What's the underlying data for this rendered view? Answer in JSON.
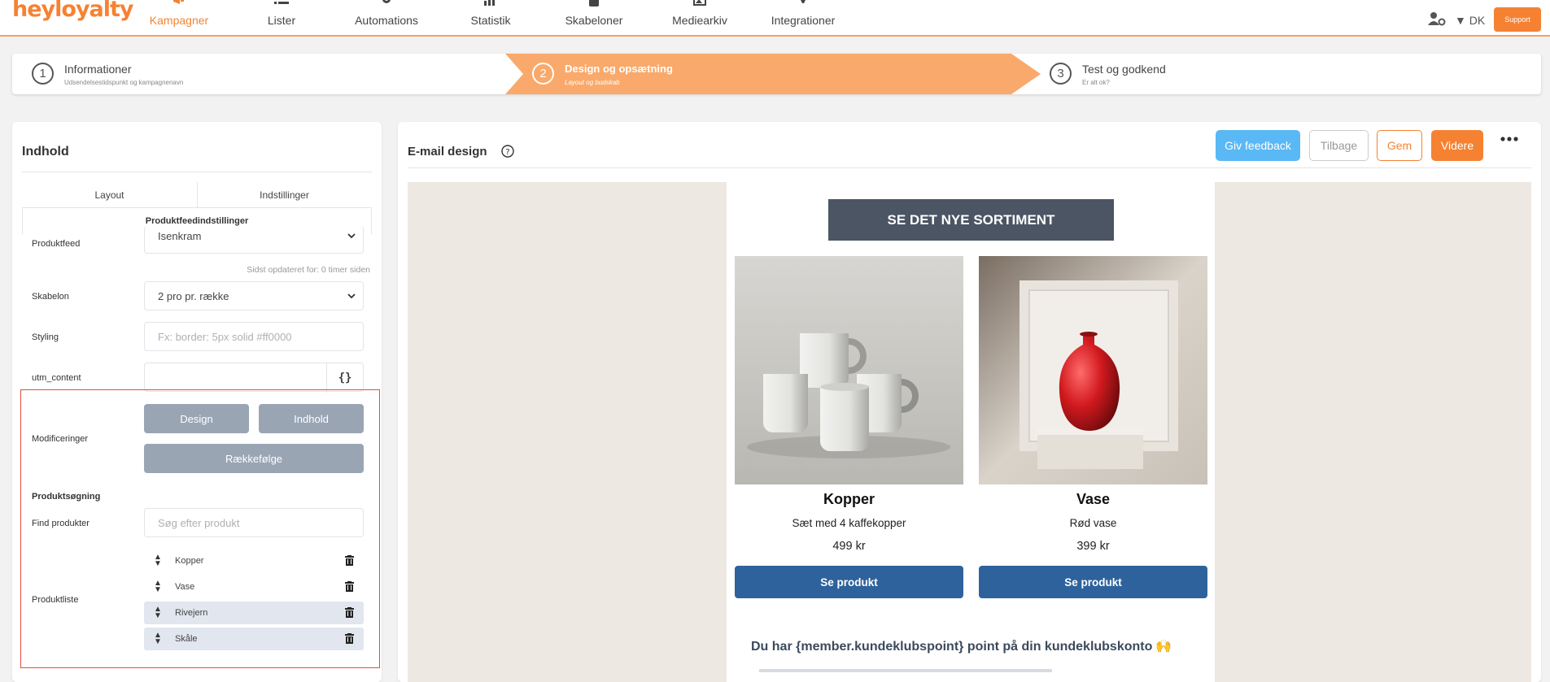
{
  "app": {
    "logo": "heyloyalty",
    "logo_mark": "®"
  },
  "nav": {
    "items": [
      {
        "label": "Kampagner",
        "icon": "megaphone-icon",
        "active": true
      },
      {
        "label": "Lister",
        "icon": "list-icon"
      },
      {
        "label": "Automations",
        "icon": "cogs-icon"
      },
      {
        "label": "Statistik",
        "icon": "bar-chart-icon"
      },
      {
        "label": "Skabeloner",
        "icon": "template-icon"
      },
      {
        "label": "Mediearkiv",
        "icon": "image-gallery-icon"
      },
      {
        "label": "Integrationer",
        "icon": "plug-icon"
      }
    ],
    "language": "DK",
    "support_label": "Support",
    "accent_color": "#f58233"
  },
  "stepper": {
    "steps": [
      {
        "num": "1",
        "title": "Informationer",
        "sub": "Udsendelsestidspunkt og kampagnenavn"
      },
      {
        "num": "2",
        "title": "Design og opsætning",
        "sub": "Layout og budskab",
        "active": true
      },
      {
        "num": "3",
        "title": "Test og godkend",
        "sub": "Er alt ok?"
      }
    ]
  },
  "left": {
    "title": "Indhold",
    "tabs": [
      "Layout",
      "Indstillinger"
    ],
    "subtab": "Produktfeedindstillinger",
    "fields": {
      "feed_label": "Produktfeed",
      "feed_value": "Isenkram",
      "feed_hint": "Sidst opdateret for: 0 timer siden",
      "template_label": "Skabelon",
      "template_value": "2 pro pr. række",
      "styling_label": "Styling",
      "styling_placeholder": "Fx: border: 5px solid #ff0000",
      "utm_label": "utm_content",
      "utm_value": "",
      "utm_button": "{}"
    },
    "modifications": {
      "label": "Modificeringer",
      "design": "Design",
      "content": "Indhold",
      "order": "Rækkefølge"
    },
    "search": {
      "section": "Produktsøgning",
      "find_label": "Find produkter",
      "find_placeholder": "Søg efter produkt"
    },
    "product_list": {
      "label": "Produktliste",
      "items": [
        "Kopper",
        "Vase",
        "Rivejern",
        "Skåle"
      ]
    }
  },
  "right": {
    "title": "E-mail design",
    "buttons": {
      "feedback": "Giv feedback",
      "back": "Tilbage",
      "save": "Gem",
      "next": "Videre"
    },
    "email": {
      "hero": "SE DET NYE SORTIMENT",
      "products": [
        {
          "name": "Kopper",
          "desc": "Sæt med 4 kaffekopper",
          "price": "499 kr",
          "cta": "Se produkt"
        },
        {
          "name": "Vase",
          "desc": "Rød vase",
          "price": "399 kr",
          "cta": "Se produkt"
        }
      ],
      "points_text": "Du har {member.kundeklubspoint} point på din kundeklubskonto",
      "points_emoji": "🙌"
    }
  }
}
